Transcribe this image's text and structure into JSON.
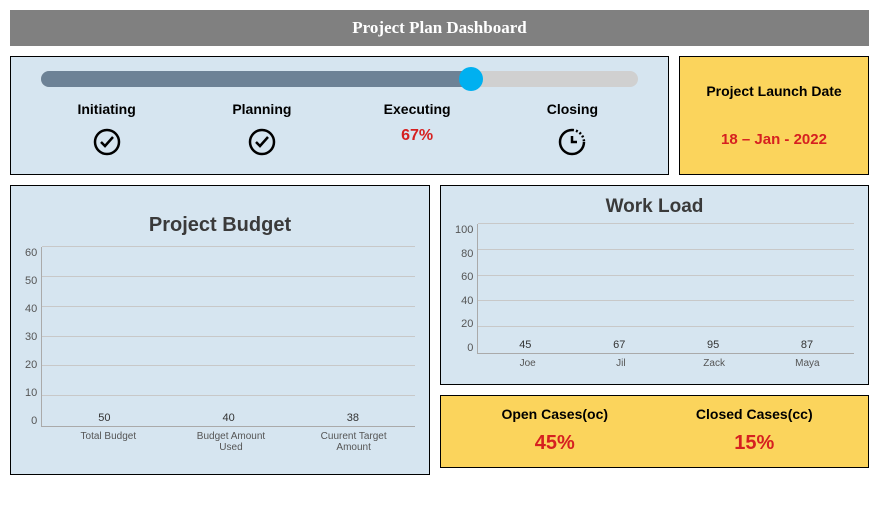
{
  "title": "Project Plan Dashboard",
  "progress_percent": 72,
  "phases": {
    "initiating": {
      "label": "Initiating",
      "status": "done"
    },
    "planning": {
      "label": "Planning",
      "status": "done"
    },
    "executing": {
      "label": "Executing",
      "percent": "67%"
    },
    "closing": {
      "label": "Closing",
      "status": "pending"
    }
  },
  "launch": {
    "title": "Project Launch Date",
    "date": "18 – Jan - 2022"
  },
  "cases": {
    "open": {
      "label": "Open Cases(oc)",
      "value": "45%"
    },
    "closed": {
      "label": "Closed Cases(cc)",
      "value": "15%"
    }
  },
  "chart_data": [
    {
      "type": "bar",
      "title": "Project Budget",
      "categories": [
        "Total Budget",
        "Budget Amount Used",
        "Cuurent Target Amount"
      ],
      "values": [
        50,
        40,
        38
      ],
      "colors": [
        "#f8b500",
        "#86c157",
        "#f5a86f"
      ],
      "ylim": [
        0,
        60
      ],
      "ystep": 10
    },
    {
      "type": "bar",
      "title": "Work Load",
      "categories": [
        "Joe",
        "Jil",
        "Zack",
        "Maya"
      ],
      "values": [
        45,
        67,
        95,
        87
      ],
      "ylim": [
        0,
        100
      ],
      "ystep": 20
    }
  ]
}
